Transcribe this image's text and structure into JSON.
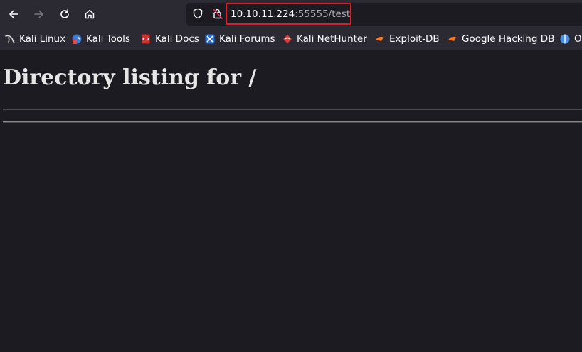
{
  "toolbar": {
    "url_host": "10.10.11.224",
    "url_rest": ":55555/test"
  },
  "bookmarks": [
    {
      "label": "Kali Linux",
      "icon": "kali-dragon-icon"
    },
    {
      "label": "Kali Tools",
      "icon": "kali-tools-icon"
    },
    {
      "label": "Kali Docs",
      "icon": "kali-docs-icon"
    },
    {
      "label": "Kali Forums",
      "icon": "kali-forums-icon"
    },
    {
      "label": "Kali NetHunter",
      "icon": "kali-nethunter-icon"
    },
    {
      "label": "Exploit-DB",
      "icon": "exploit-db-icon"
    },
    {
      "label": "Google Hacking DB",
      "icon": "ghdb-icon"
    },
    {
      "label": "O",
      "icon": "offsec-icon"
    }
  ],
  "page": {
    "title": "Directory listing for /"
  },
  "colors": {
    "toolbar_bg": "#2b2a33",
    "page_bg": "#1c1b22",
    "highlight_border": "#d61f26"
  }
}
